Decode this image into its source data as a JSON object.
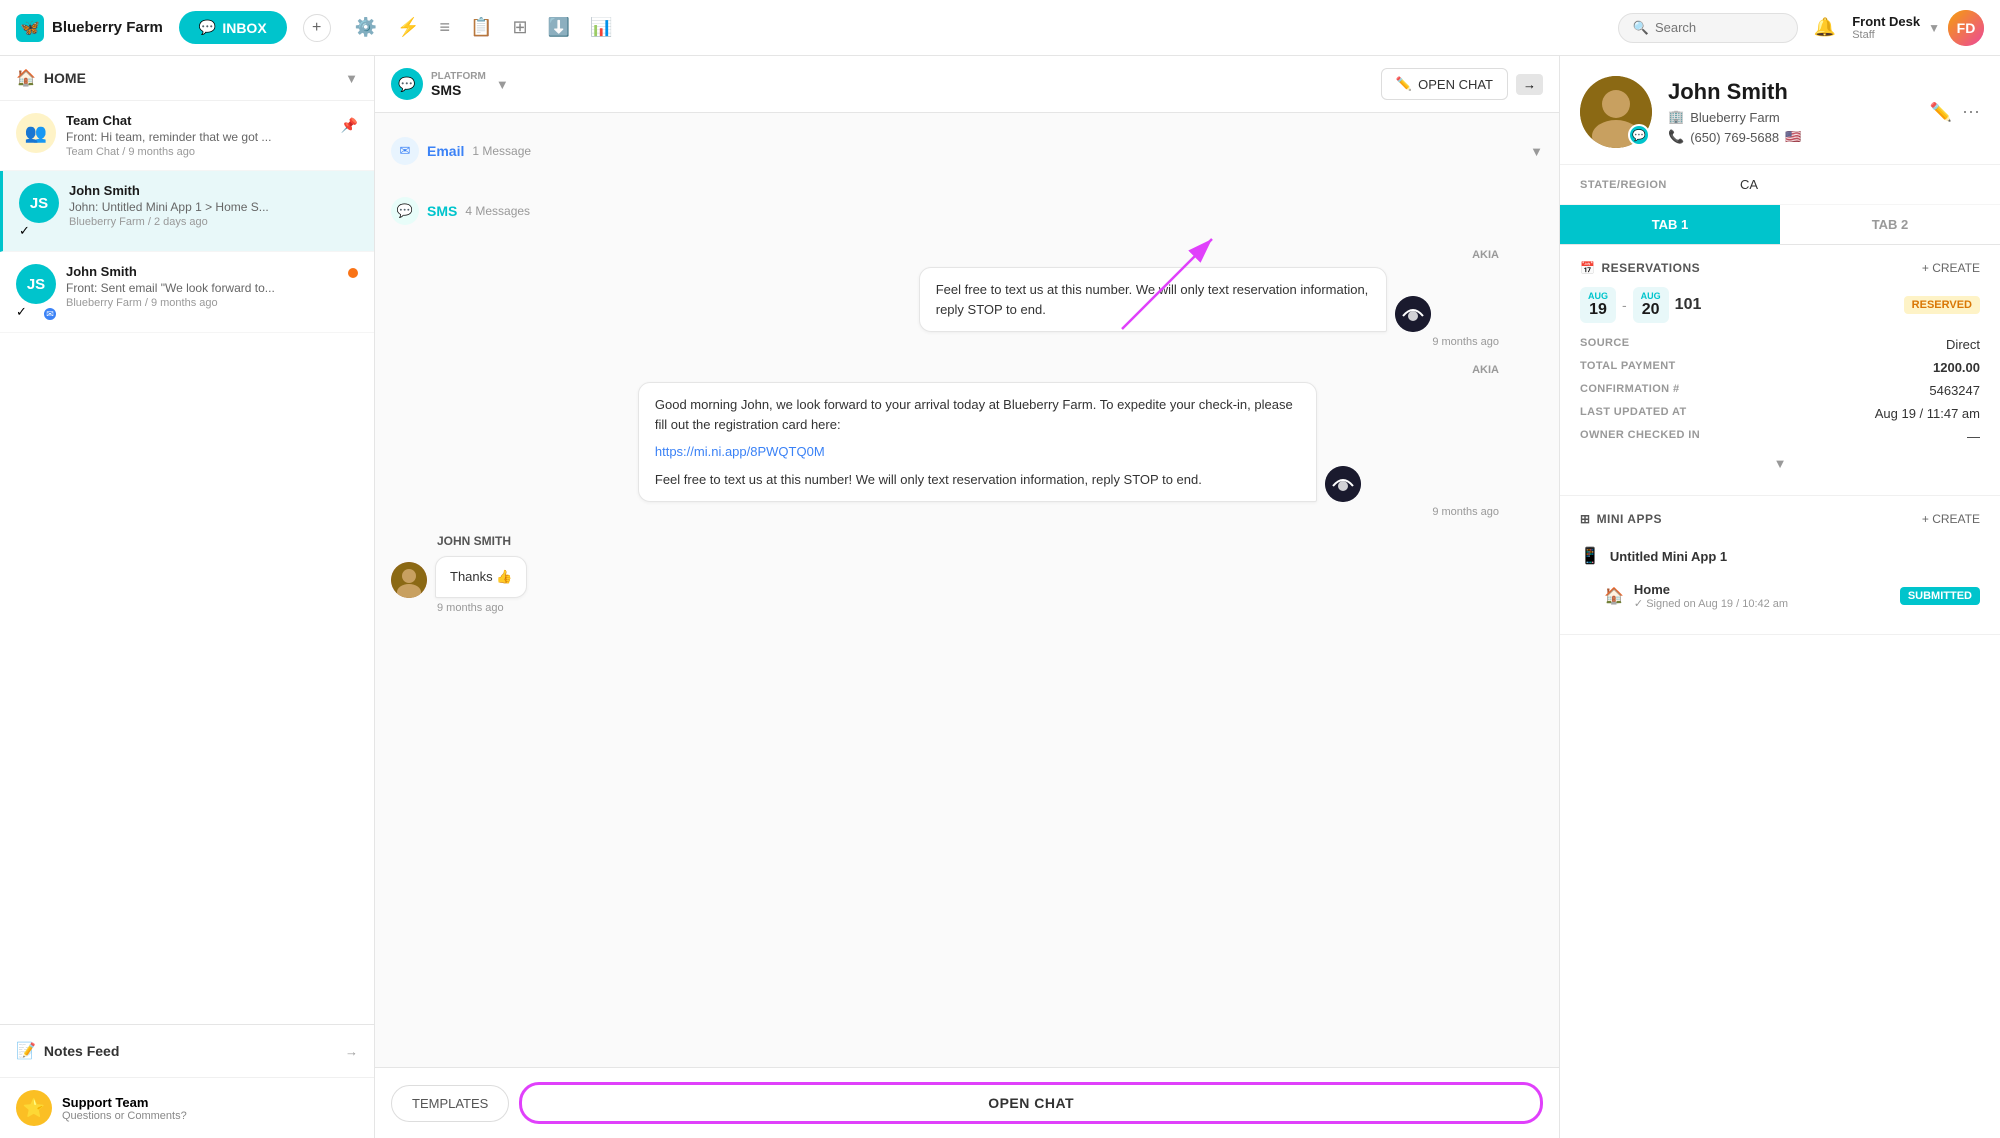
{
  "app": {
    "name": "Blueberry Farm",
    "logo_initial": "🦋"
  },
  "topnav": {
    "inbox_label": "INBOX",
    "search_placeholder": "Search",
    "user_name": "Front Desk",
    "user_role": "Staff",
    "bell_icon": "🔔"
  },
  "sidebar": {
    "home_label": "HOME",
    "conversations": [
      {
        "id": "team-chat",
        "name": "Team Chat",
        "preview": "Front: Hi team, reminder that we got ...",
        "meta": "Team Chat / 9 months ago",
        "avatar_type": "emoji",
        "avatar_emoji": "👥",
        "avatar_bg": "yellow",
        "active": false
      },
      {
        "id": "john-smith-1",
        "name": "John Smith",
        "preview": "John: Untitled Mini App 1 > Home S...",
        "meta": "Blueberry Farm / 2 days ago",
        "avatar_type": "initials",
        "avatar_bg": "teal",
        "active": true,
        "has_check": true
      },
      {
        "id": "john-smith-2",
        "name": "John Smith",
        "preview": "Front: Sent email \"We look forward to...",
        "meta": "Blueberry Farm / 9 months ago",
        "avatar_type": "initials",
        "avatar_bg": "teal",
        "has_check": true,
        "has_email_badge": true,
        "has_unread": true
      }
    ],
    "notes_feed_label": "Notes Feed",
    "support_name": "Support Team",
    "support_sub": "Questions or Comments?"
  },
  "chat": {
    "channel_platform": "PLATFORM",
    "channel_type": "SMS",
    "open_chat_btn": "OPEN CHAT",
    "email_section": {
      "label": "Email",
      "count": "1 Message"
    },
    "sms_section": {
      "label": "SMS",
      "count": "4 Messages"
    },
    "messages": [
      {
        "type": "outgoing_top",
        "text": "Feel free to text us at this number. We will only text reservation information, reply STOP to end.",
        "time": "9 months ago",
        "sender": "AKIA"
      },
      {
        "type": "outgoing_main",
        "sender": "AKIA",
        "text_main": "Good morning John, we look forward to your arrival today at Blueberry Farm. To expedite your check-in, please fill out the registration card here:",
        "link": "https://mi.ni.app/8PWQTQ0M",
        "text_footer": "Feel free to text us at this number! We will only text reservation information, reply STOP to end.",
        "time": "9 months ago"
      },
      {
        "type": "incoming",
        "sender": "JOHN SMITH",
        "text": "Thanks 👍",
        "time": "9 months ago"
      }
    ],
    "templates_btn": "TEMPLATES",
    "open_chat_main_btn": "OPEN CHAT"
  },
  "contact": {
    "name": "John Smith",
    "company": "Blueberry Farm",
    "phone": "(650) 769-5688",
    "flag": "🇺🇸",
    "building_icon": "🏢",
    "phone_icon": "📞",
    "fields": [
      {
        "label": "STATE/REGION",
        "value": "CA"
      }
    ],
    "tabs": [
      {
        "id": "tab1",
        "label": "TAB 1",
        "active": true
      },
      {
        "id": "tab2",
        "label": "TAB 2",
        "active": false
      }
    ],
    "reservations": {
      "section_title": "RESERVATIONS",
      "create_label": "+ CREATE",
      "item": {
        "date_start_month": "AUG",
        "date_start_day": "19",
        "date_end_month": "AUG",
        "date_end_day": "20",
        "room": "101",
        "status": "RESERVED",
        "details": [
          {
            "label": "SOURCE",
            "value": "Direct"
          },
          {
            "label": "TOTAL PAYMENT",
            "value": "1200.00"
          },
          {
            "label": "CONFIRMATION #",
            "value": "5463247"
          },
          {
            "label": "LAST UPDATED AT",
            "value": "Aug 19 / 11:47 am"
          },
          {
            "label": "OWNER CHECKED IN",
            "value": "—"
          }
        ]
      }
    },
    "mini_apps": {
      "section_title": "MINI APPS",
      "create_label": "+ CREATE",
      "items": [
        {
          "name": "Untitled Mini App 1",
          "sub_items": [
            {
              "name": "Home",
              "signed_label": "Signed on Aug 19 / 10:42 am",
              "status": "SUBMITTED"
            }
          ]
        }
      ]
    }
  }
}
